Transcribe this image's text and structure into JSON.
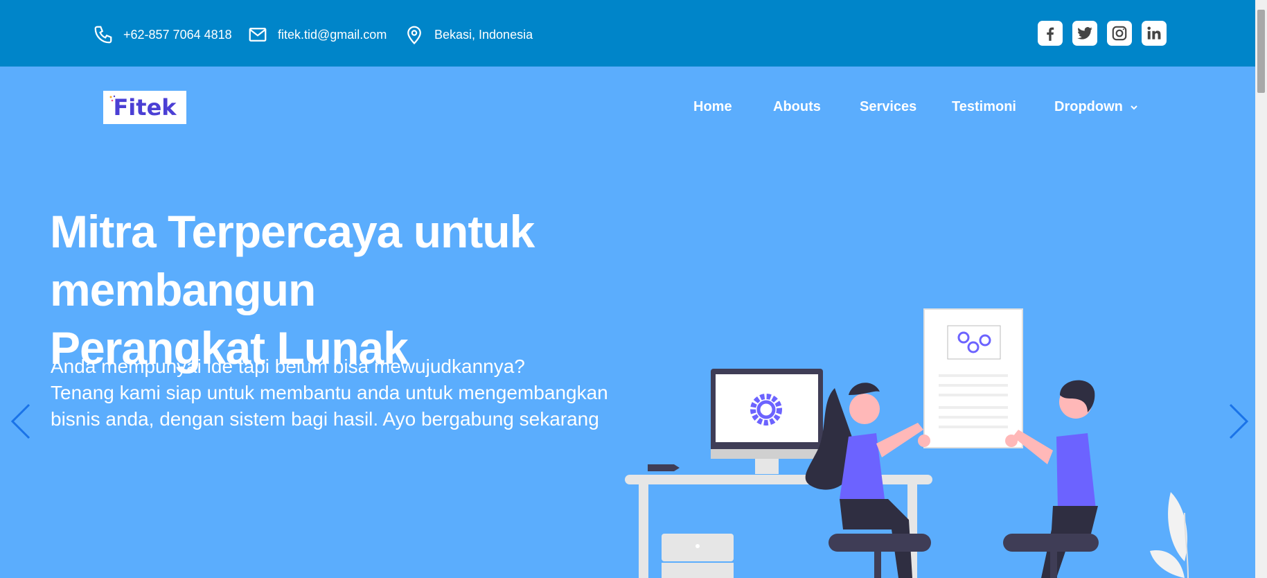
{
  "topbar": {
    "phone": "+62-857 7064 4818",
    "email": "fitek.tid@gmail.com",
    "location": "Bekasi, Indonesia",
    "social": [
      "facebook-icon",
      "twitter-icon",
      "instagram-icon",
      "linkedin-icon"
    ]
  },
  "logo": {
    "text": "Fitek"
  },
  "nav": {
    "items": [
      "Home",
      "Abouts",
      "Services",
      "Testimoni",
      "Dropdown"
    ]
  },
  "hero": {
    "title_line1": "Mitra Terpercaya untuk membangun",
    "title_line2": "Perangkat Lunak",
    "subtitle_line1": "Anda mempunyai ide tapi belum bisa mewujudkannya?",
    "subtitle_line2": "Tenang kami siap untuk membantu anda untuk mengembangkan",
    "subtitle_line3": "bisnis anda, dengan sistem bagi hasil. Ayo bergabung sekarang"
  },
  "colors": {
    "topbar": "#0085c9",
    "hero_bg": "#5badfd",
    "accent": "#6c63ff",
    "arrow": "#1a73e8"
  }
}
